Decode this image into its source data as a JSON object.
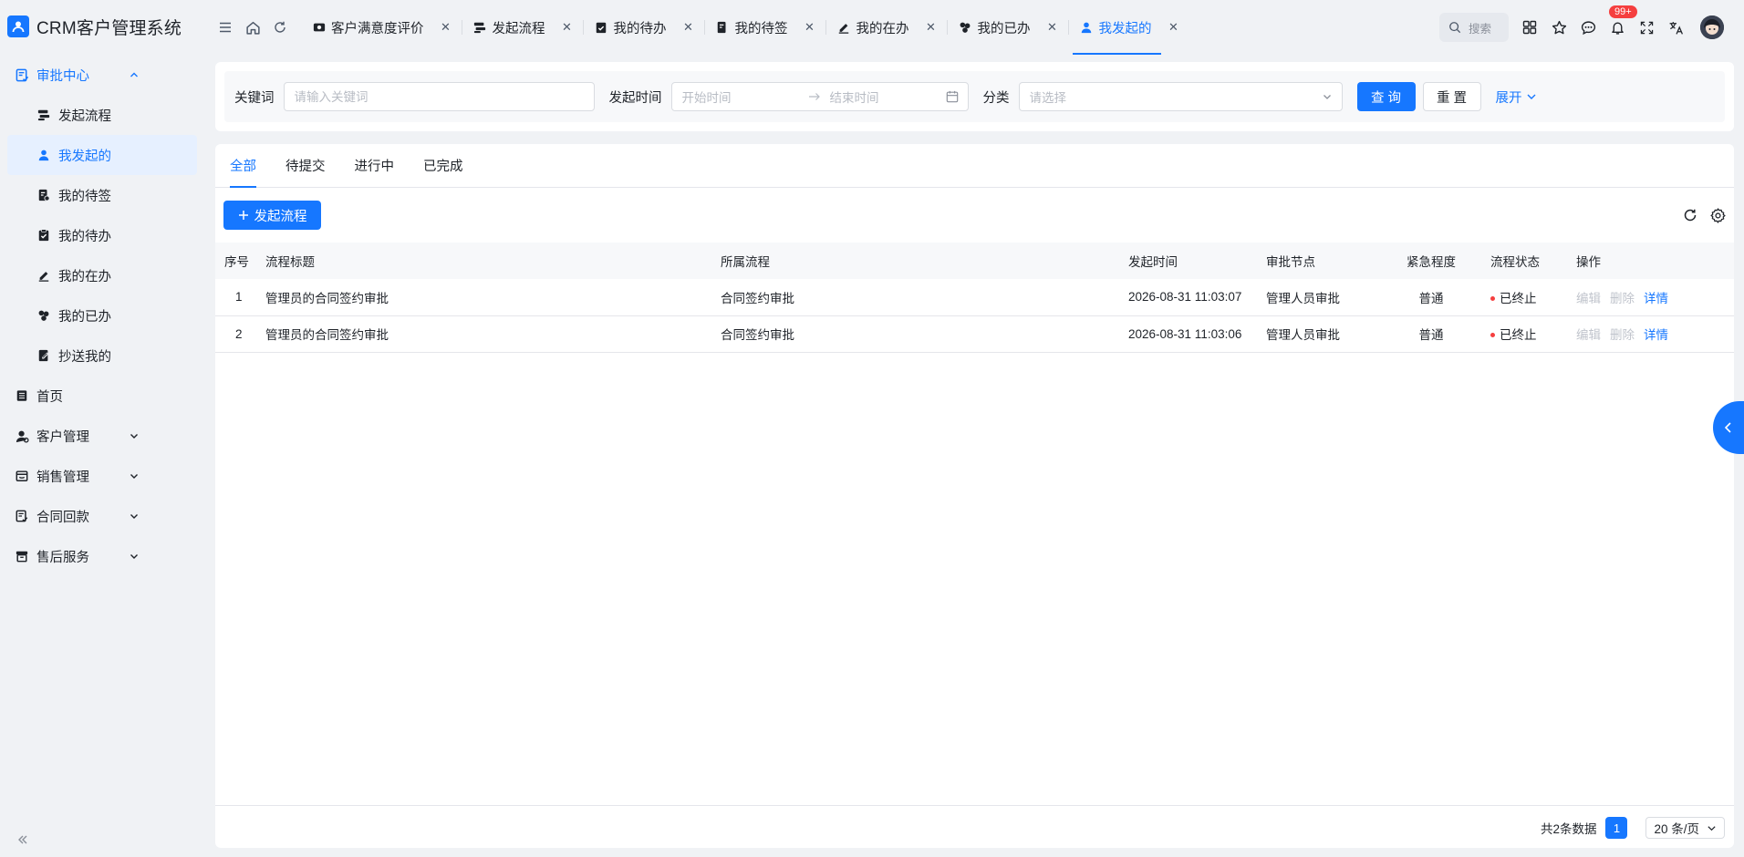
{
  "app": {
    "title": "CRM客户管理系统"
  },
  "sidebar": {
    "group": {
      "label": "审批中心"
    },
    "sub_items": [
      {
        "label": "发起流程",
        "icon": "flow-icon"
      },
      {
        "label": "我发起的",
        "icon": "user-icon",
        "active": true
      },
      {
        "label": "我的待签",
        "icon": "sign-icon"
      },
      {
        "label": "我的待办",
        "icon": "clipboard-check-icon"
      },
      {
        "label": "我的在办",
        "icon": "pen-icon"
      },
      {
        "label": "我的已办",
        "icon": "done-icon"
      },
      {
        "label": "抄送我的",
        "icon": "cc-icon"
      }
    ],
    "items": [
      {
        "label": "首页",
        "icon": "home-list-icon"
      },
      {
        "label": "客户管理",
        "icon": "customer-icon"
      },
      {
        "label": "销售管理",
        "icon": "sales-icon"
      },
      {
        "label": "合同回款",
        "icon": "contract-icon"
      },
      {
        "label": "售后服务",
        "icon": "service-icon"
      }
    ]
  },
  "tabs": [
    {
      "label": "客户满意度评价"
    },
    {
      "label": "发起流程"
    },
    {
      "label": "我的待办"
    },
    {
      "label": "我的待签"
    },
    {
      "label": "我的在办"
    },
    {
      "label": "我的已办"
    },
    {
      "label": "我发起的",
      "active": true
    }
  ],
  "header": {
    "search_placeholder": "搜索",
    "badge": "99+"
  },
  "filter": {
    "keyword_label": "关键词",
    "keyword_placeholder": "请输入关键词",
    "time_label": "发起时间",
    "start_placeholder": "开始时间",
    "end_placeholder": "结束时间",
    "category_label": "分类",
    "category_placeholder": "请选择",
    "query_label": "查 询",
    "reset_label": "重 置",
    "expand_label": "展开"
  },
  "status_tabs": [
    "全部",
    "待提交",
    "进行中",
    "已完成"
  ],
  "toolbar": {
    "add_label": "发起流程"
  },
  "table": {
    "columns": [
      "序号",
      "流程标题",
      "所属流程",
      "发起时间",
      "审批节点",
      "紧急程度",
      "流程状态",
      "操作"
    ],
    "rows": [
      {
        "no": "1",
        "title": "管理员的合同签约审批",
        "flow": "合同签约审批",
        "time": "2026-08-31 11:03:07",
        "node": "管理人员审批",
        "urgency": "普通",
        "status": "已终止",
        "op_edit": "编辑",
        "op_delete": "删除",
        "op_detail": "详情"
      },
      {
        "no": "2",
        "title": "管理员的合同签约审批",
        "flow": "合同签约审批",
        "time": "2026-08-31 11:03:06",
        "node": "管理人员审批",
        "urgency": "普通",
        "status": "已终止",
        "op_edit": "编辑",
        "op_delete": "删除",
        "op_detail": "详情"
      }
    ]
  },
  "pager": {
    "total_text": "共2条数据",
    "current_page": "1",
    "page_size": "20 条/页"
  },
  "colors": {
    "accent": "#1677ff",
    "danger": "#f53f3f",
    "page_bg": "#f0f2f5"
  }
}
